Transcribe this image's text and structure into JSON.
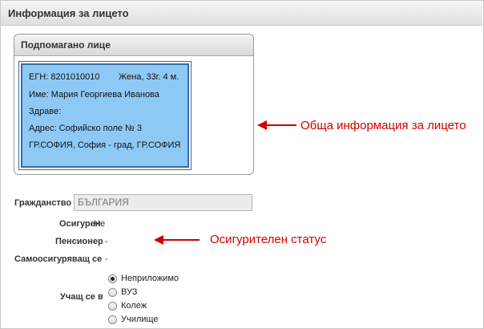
{
  "panel": {
    "title": "Информация за лицето"
  },
  "person_section": {
    "title": "Подпомагано лице",
    "egn_line": "ЕГН: 8201010010",
    "gender_age": "Жена, 33г. 4 м.",
    "name_line": "Име: Мария Георгиева Иванова",
    "health_line": "Здраве:",
    "address_line": "Адрес: Софийско поле № 3",
    "city_line": "ГР.СОФИЯ, София - град, ГР.СОФИЯ"
  },
  "annotations": {
    "general_info": "Обща информация за лицето",
    "insurance_status": "Осигурителен статус"
  },
  "citizenship": {
    "label": "Гражданство",
    "value": "БЪЛГАРИЯ"
  },
  "status": {
    "insured_label": "Осигурен",
    "insured_value": "Не",
    "pensioner_label": "Пенсионер",
    "pensioner_value": "-",
    "self_insured_label": "Самоосигуряващ се",
    "self_insured_value": "-"
  },
  "studying": {
    "label": "Учащ се в",
    "options": [
      {
        "label": "Неприложимо",
        "checked": true
      },
      {
        "label": "ВУЗ",
        "checked": false
      },
      {
        "label": "Колеж",
        "checked": false
      },
      {
        "label": "Училище",
        "checked": false
      }
    ]
  },
  "colors": {
    "annotation": "#d10000",
    "info_box_bg": "#8ec9f6",
    "info_box_border": "#3b6aa3"
  }
}
